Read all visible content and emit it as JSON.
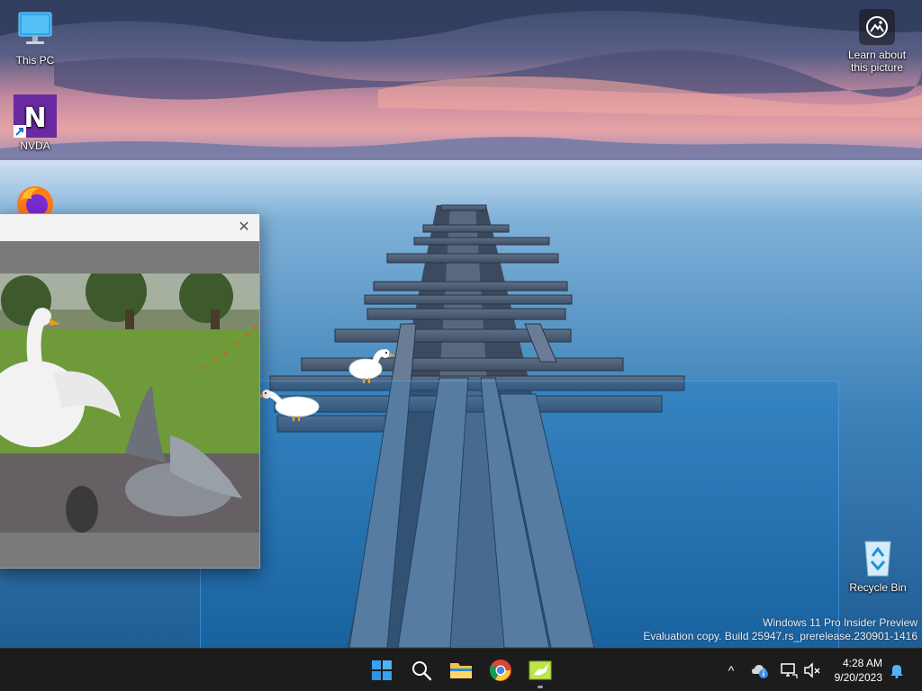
{
  "desktop": {
    "icons": [
      {
        "label": "This PC",
        "icon": "this-pc-icon"
      },
      {
        "label": "NVDA",
        "icon": "nvda-icon"
      },
      {
        "label": "",
        "icon": "firefox-icon"
      }
    ],
    "recycle_bin": {
      "label": "Recycle Bin",
      "icon": "recycle-bin-icon"
    },
    "spotlight": {
      "label": "Learn about this picture",
      "icon": "camera-icon"
    },
    "watermark": {
      "line1": "Windows 11 Pro Insider Preview",
      "line2": "Evaluation copy. Build 25947.rs_prerelease.230901-1416"
    }
  },
  "video_window": {
    "title": "",
    "close_symbol": "✕"
  },
  "taskbar": {
    "apps": [
      {
        "name": "Start",
        "icon": "windows-start-icon"
      },
      {
        "name": "Search",
        "icon": "search-icon"
      },
      {
        "name": "File Explorer",
        "icon": "file-explorer-icon"
      },
      {
        "name": "Google Chrome",
        "icon": "chrome-icon"
      },
      {
        "name": "Desktop Goose",
        "icon": "goose-app-icon"
      }
    ],
    "tray": {
      "chevron_symbol": "^",
      "time": "4:28 AM",
      "date": "9/20/2023"
    }
  },
  "colors": {
    "taskbar": "#1c1c1c",
    "accent": "#0078d4",
    "nvda_purple": "#6a2aa0"
  }
}
